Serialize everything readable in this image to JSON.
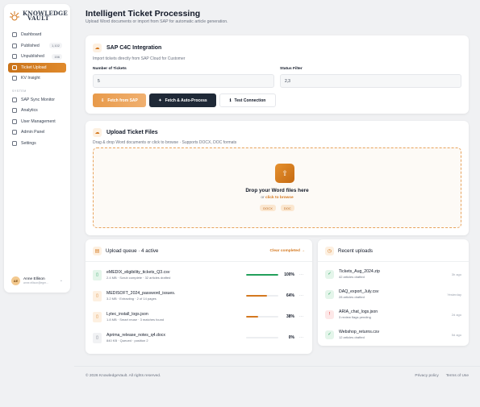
{
  "brand": {
    "line1": "KNOWLEDGE",
    "line2": "VAULT"
  },
  "sidebar": {
    "items": [
      {
        "label": "Dashboard",
        "icon": "grid-icon"
      },
      {
        "label": "Published",
        "badge": "1,102",
        "icon": "document-icon"
      },
      {
        "label": "Unpublished",
        "badge": "156",
        "icon": "draft-icon"
      },
      {
        "label": "Ticket Upload",
        "icon": "upload-icon",
        "active": true
      },
      {
        "label": "KV Insight",
        "icon": "insight-icon"
      }
    ],
    "section_label": "SYSTEM",
    "system_items": [
      {
        "label": "SAP Sync Monitor",
        "icon": "sync-icon"
      },
      {
        "label": "Analytics",
        "icon": "chart-icon"
      },
      {
        "label": "User Management",
        "icon": "users-icon"
      },
      {
        "label": "Admin Panel",
        "icon": "shield-icon"
      },
      {
        "label": "Settings",
        "icon": "gear-icon"
      }
    ],
    "user": {
      "initials": "AE",
      "name": "Anne Ellison",
      "email": "anne.ellison@egm..."
    }
  },
  "page": {
    "title": "Intelligent Ticket Processing",
    "subtitle": "Upload Word documents or import from SAP for automatic article generation."
  },
  "sap": {
    "title": "SAP C4C Integration",
    "desc": "Import tickets directly from SAP Cloud for Customer",
    "num_label": "Number of Tickets",
    "num_value": "5",
    "status_label": "Status Filter",
    "status_value": "2,3",
    "fetch_label": "Fetch from SAP",
    "fetch_process_label": "Fetch & Auto-Process",
    "test_label": "Test Connection"
  },
  "upload": {
    "title": "Upload Ticket Files",
    "desc": "Drag & drop Word documents or click to browse · Supports DOCX, DOC formats",
    "drop_title": "Drop your Word files here",
    "or": "or ",
    "browse": "click to browse",
    "formats": [
      "DOCX",
      "DOC"
    ]
  },
  "queue": {
    "title": "Upload queue · 4 active",
    "clear": "Clear completed →",
    "rows": [
      {
        "name": "eMEDIX_eligibility_tickets_Q3.csv",
        "meta": "2.4 MB · Scrub complete · 32 articles drafted",
        "progress": 100,
        "pct": "100%",
        "color": "#22a05b",
        "icon_bg": "#e4f5ea",
        "icon_fg": "#22a05b"
      },
      {
        "name": "MEDISOFT_2024_password_issues.",
        "meta": "3.2 MB · Extracting · 2 of 14 pages",
        "progress": 64,
        "pct": "64%",
        "color": "#d4781f",
        "icon_bg": "#fdf0e1",
        "icon_fg": "#d4781f"
      },
      {
        "name": "Lytec_install_logs.json",
        "meta": "1.8 MB · Smart reuse · 3 matches found",
        "progress": 38,
        "pct": "38%",
        "color": "#d4781f",
        "icon_bg": "#fdf0e1",
        "icon_fg": "#d4781f"
      },
      {
        "name": "Aprima_release_notes_q4.docx",
        "meta": "840 KB · Queued · position 2",
        "progress": 0,
        "pct": "0%",
        "color": "#d1d5db",
        "icon_bg": "#f1f2f4",
        "icon_fg": "#6b7280"
      }
    ]
  },
  "recent": {
    "title": "Recent uploads",
    "rows": [
      {
        "name": "Tickets_Aug_2024.zip",
        "meta": "42 articles drafted",
        "when": "3h ago",
        "status": "ok"
      },
      {
        "name": "DAQ_export_July.csv",
        "meta": "28 articles drafted",
        "when": "Yesterday",
        "status": "ok"
      },
      {
        "name": "ARIA_chat_logs.json",
        "meta": "3 review flags pending",
        "when": "2d ago",
        "status": "warn"
      },
      {
        "name": "Webshop_returns.csv",
        "meta": "12 articles drafted",
        "when": "5d ago",
        "status": "ok"
      }
    ]
  },
  "footer": {
    "copy": "© 2026 KnowledgeVault. All rights reserved.",
    "privacy": "Privacy policy",
    "terms": "Terms of Use"
  }
}
